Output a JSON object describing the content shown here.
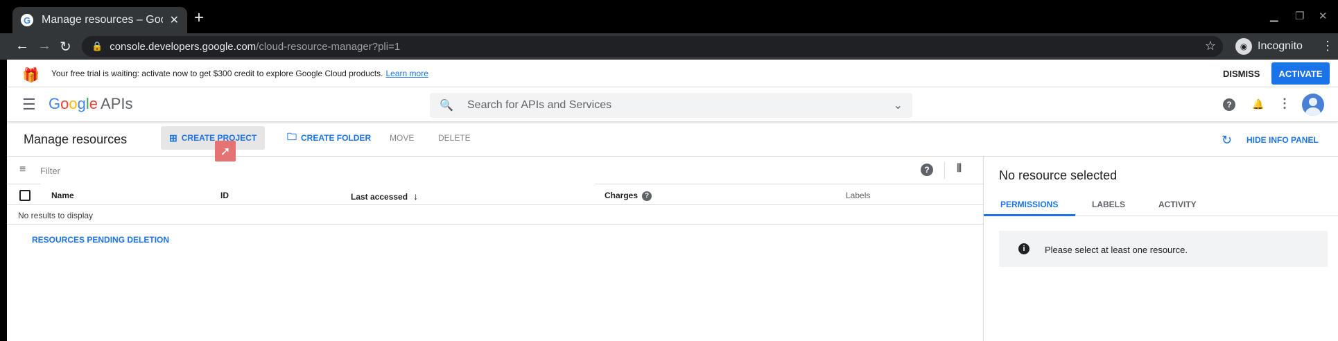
{
  "browser": {
    "tab_title": "Manage resources – Goog",
    "favicon": "G",
    "close": "✕",
    "new_tab": "+",
    "url_host": "console.developers.google.com",
    "url_path": "/cloud-resource-manager?pli=1",
    "profile_label": "Incognito"
  },
  "banner": {
    "message": "Your free trial is waiting: activate now to get $300 credit to explore Google Cloud products.",
    "learn_more": "Learn more",
    "dismiss": "DISMISS",
    "activate": "ACTIVATE"
  },
  "header": {
    "logo_letters": [
      "G",
      "o",
      "o",
      "g",
      "l",
      "e"
    ],
    "logo_suffix": "APIs",
    "search_placeholder": "Search for APIs and Services"
  },
  "toolbar": {
    "page_title": "Manage resources",
    "create_project": "CREATE PROJECT",
    "create_folder": "CREATE FOLDER",
    "move": "MOVE",
    "delete": "DELETE",
    "hide_info_panel": "HIDE INFO PANEL"
  },
  "table": {
    "filter_placeholder": "Filter",
    "columns": [
      "Name",
      "ID",
      "Last accessed",
      "Charges",
      "Labels"
    ],
    "empty_text": "No results to display",
    "pending_link": "RESOURCES PENDING DELETION"
  },
  "info_panel": {
    "title": "No resource selected",
    "tabs": [
      "PERMISSIONS",
      "LABELS",
      "ACTIVITY"
    ],
    "notice": "Please select at least one resource."
  },
  "colors": {
    "accent": "#1a73e8",
    "cursor_highlight": "#e57373"
  }
}
